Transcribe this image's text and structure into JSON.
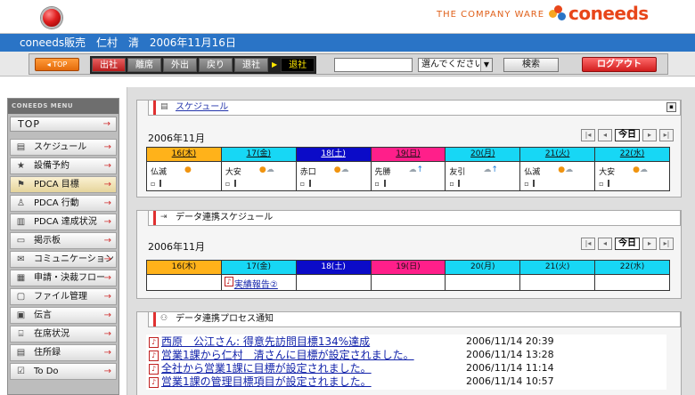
{
  "header": {
    "tagline": "THE COMPANY WARE",
    "brand": "coneeds",
    "brand_colors": [
      "#e8461a",
      "#f6a623",
      "#2a74c6"
    ]
  },
  "userbar": {
    "company": "coneeds販売",
    "user": "仁村　清",
    "date": "2006年11月16日"
  },
  "toolbar": {
    "top_label": "TOP",
    "status_buttons": [
      "出社",
      "離席",
      "外出",
      "戻り",
      "退社"
    ],
    "current_status": "退社",
    "search_value": "",
    "select_value": "選んでください",
    "search_label": "検索",
    "logout_label": "ログアウト"
  },
  "sidebar": {
    "heading": "CONEEDS MENU",
    "top": "TOP",
    "items": [
      {
        "label": "スケジュール",
        "icon": "calendar-icon"
      },
      {
        "label": "設備予約",
        "icon": "star-icon"
      },
      {
        "label": "PDCA 目標",
        "icon": "flag-icon"
      },
      {
        "label": "PDCA 行動",
        "icon": "person-icon"
      },
      {
        "label": "PDCA 達成状況",
        "icon": "chart-icon"
      },
      {
        "label": "掲示板",
        "icon": "board-icon"
      },
      {
        "label": "コミュニケーション",
        "icon": "mail-icon"
      },
      {
        "label": "申請・決裁フロー",
        "icon": "form-icon"
      },
      {
        "label": "ファイル管理",
        "icon": "folder-icon"
      },
      {
        "label": "伝言",
        "icon": "memo-icon"
      },
      {
        "label": "在席状況",
        "icon": "seat-icon"
      },
      {
        "label": "住所録",
        "icon": "address-icon"
      },
      {
        "label": "To Do",
        "icon": "check-icon"
      }
    ]
  },
  "schedule": {
    "title": "スケジュール",
    "month": "2006年11月",
    "today_label": "今日",
    "days": [
      {
        "label": "16(木)",
        "kind": "thu",
        "rokuyo": "仏滅",
        "weather": "sun"
      },
      {
        "label": "17(金)",
        "kind": "fri",
        "rokuyo": "大安",
        "weather": "sun-cloud"
      },
      {
        "label": "18(土)",
        "kind": "sat",
        "rokuyo": "赤口",
        "weather": "sun-cloud"
      },
      {
        "label": "19(日)",
        "kind": "sun",
        "rokuyo": "先勝",
        "weather": "cloud-up"
      },
      {
        "label": "20(月)",
        "kind": "fri",
        "rokuyo": "友引",
        "weather": "cloud-up"
      },
      {
        "label": "21(火)",
        "kind": "fri",
        "rokuyo": "仏滅",
        "weather": "sun-cloud"
      },
      {
        "label": "22(水)",
        "kind": "fri",
        "rokuyo": "大安",
        "weather": "sun-cloud"
      }
    ]
  },
  "linked_schedule": {
    "title": "データ連携スケジュール",
    "month": "2006年11月",
    "today_label": "今日",
    "days": [
      "16(木)",
      "17(金)",
      "18(土)",
      "19(日)",
      "20(月)",
      "21(火)",
      "22(水)"
    ],
    "event": {
      "day_index": 1,
      "label": "実績報告②"
    }
  },
  "process_notice": {
    "title": "データ連携プロセス通知",
    "items": [
      {
        "text": "西原　公江さん: 得意先訪問目標134%達成",
        "when": "2006/11/14 20:39"
      },
      {
        "text": "営業1課から仁村　清さんに目標が設定されました。",
        "when": "2006/11/14 13:28"
      },
      {
        "text": "全社から営業1課に目標が設定されました。",
        "when": "2006/11/14 11:14"
      },
      {
        "text": "営業1課の管理目標項目が設定されました。",
        "when": "2006/11/14 10:57"
      }
    ]
  }
}
